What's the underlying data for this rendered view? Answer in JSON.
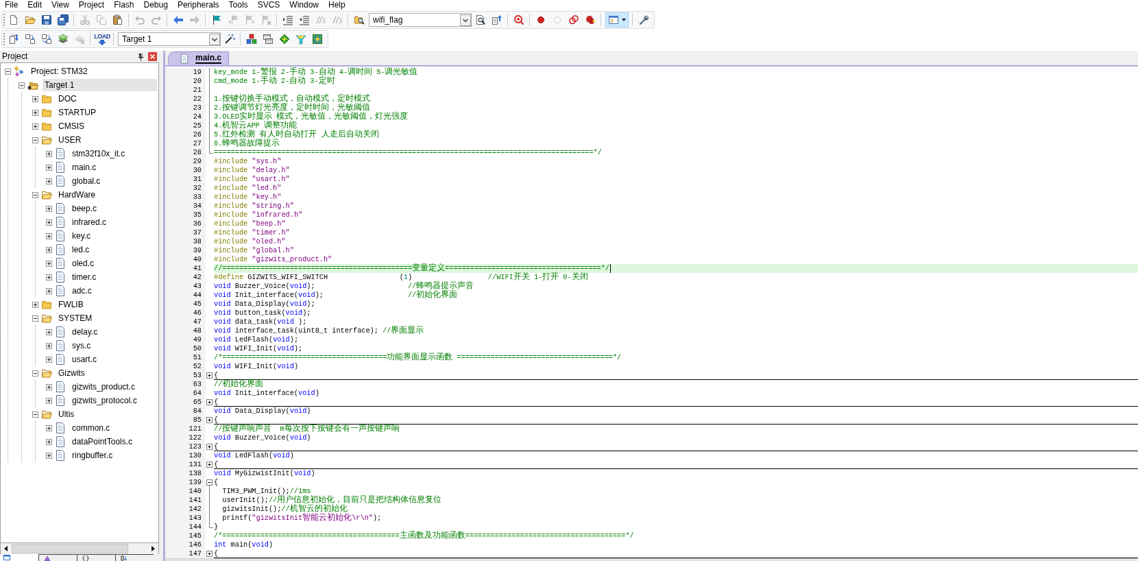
{
  "menu": [
    "File",
    "Edit",
    "View",
    "Project",
    "Flash",
    "Debug",
    "Peripherals",
    "Tools",
    "SVCS",
    "Window",
    "Help"
  ],
  "toolbar_1": [
    {
      "kind": "new",
      "disabled": false,
      "pressed": false
    },
    {
      "kind": "open",
      "disabled": false,
      "pressed": false
    },
    {
      "kind": "save",
      "disabled": false,
      "pressed": false
    },
    {
      "kind": "saveall",
      "disabled": false,
      "pressed": false
    },
    {
      "kind": "separator"
    },
    {
      "kind": "cut",
      "disabled": true,
      "pressed": false
    },
    {
      "kind": "copy",
      "disabled": true,
      "pressed": false
    },
    {
      "kind": "paste",
      "disabled": false,
      "pressed": false
    },
    {
      "kind": "separator"
    },
    {
      "kind": "undo",
      "disabled": true,
      "pressed": false
    },
    {
      "kind": "redo",
      "disabled": true,
      "pressed": false
    },
    {
      "kind": "separator"
    },
    {
      "kind": "back",
      "disabled": false,
      "pressed": false
    },
    {
      "kind": "forward",
      "disabled": true,
      "pressed": false
    },
    {
      "kind": "separator"
    },
    {
      "kind": "bookmark",
      "disabled": false,
      "pressed": false
    },
    {
      "kind": "prevbookmark",
      "disabled": true,
      "pressed": false
    },
    {
      "kind": "nextbookmark",
      "disabled": true,
      "pressed": false
    },
    {
      "kind": "clearbookmarks",
      "disabled": true,
      "pressed": false
    },
    {
      "kind": "separator"
    },
    {
      "kind": "indent",
      "disabled": false,
      "pressed": false
    },
    {
      "kind": "unindent",
      "disabled": false,
      "pressed": false
    },
    {
      "kind": "comment",
      "disabled": true,
      "pressed": false
    },
    {
      "kind": "uncomment",
      "disabled": true,
      "pressed": false
    },
    {
      "kind": "separator"
    },
    {
      "kind": "findinfiles",
      "disabled": false,
      "pressed": false
    },
    {
      "kind": "combo",
      "value": "wifi_flag"
    },
    {
      "kind": "find",
      "disabled": false,
      "pressed": false
    },
    {
      "kind": "incfind",
      "disabled": false,
      "pressed": false
    },
    {
      "kind": "separator"
    },
    {
      "kind": "debug",
      "disabled": false,
      "pressed": false
    },
    {
      "kind": "separator"
    },
    {
      "kind": "breakpoint",
      "disabled": false,
      "pressed": false
    },
    {
      "kind": "togglebreakpoint",
      "disabled": true,
      "pressed": false
    },
    {
      "kind": "disablebreakpoints",
      "disabled": false,
      "pressed": false
    },
    {
      "kind": "killbreakpoints",
      "disabled": false,
      "pressed": false
    },
    {
      "kind": "separator"
    },
    {
      "kind": "windows",
      "disabled": false,
      "pressed": true
    },
    {
      "kind": "separator"
    },
    {
      "kind": "wrench",
      "disabled": false,
      "pressed": false
    }
  ],
  "toolbar_2": [
    {
      "kind": "translate",
      "disabled": false,
      "pressed": false
    },
    {
      "kind": "build",
      "disabled": false,
      "pressed": false
    },
    {
      "kind": "rebuild",
      "disabled": false,
      "pressed": false
    },
    {
      "kind": "batchbuild",
      "disabled": false,
      "pressed": false
    },
    {
      "kind": "stopbuild",
      "disabled": true,
      "pressed": false
    },
    {
      "kind": "separator"
    },
    {
      "kind": "download",
      "label": "LOAD",
      "disabled": false,
      "pressed": false
    },
    {
      "kind": "separator"
    },
    {
      "kind": "combo",
      "value": "Target 1"
    },
    {
      "kind": "targetoptions",
      "disabled": false,
      "pressed": false
    },
    {
      "kind": "separator"
    },
    {
      "kind": "components",
      "disabled": false,
      "pressed": false
    },
    {
      "kind": "multiproject",
      "disabled": false,
      "pressed": false
    },
    {
      "kind": "packs",
      "disabled": false,
      "pressed": false
    },
    {
      "kind": "packinstaller",
      "disabled": false,
      "pressed": false
    },
    {
      "kind": "runtime",
      "disabled": false,
      "pressed": false
    }
  ],
  "project_panel": {
    "title": "Project",
    "tree": [
      {
        "label": "Project: STM32",
        "kind": "project",
        "expanded": true,
        "selected": false,
        "children": [
          {
            "label": "Target 1",
            "kind": "target",
            "expanded": true,
            "selected": true,
            "children": [
              {
                "label": "DOC",
                "kind": "group",
                "expanded": false,
                "selected": false
              },
              {
                "label": "STARTUP",
                "kind": "group",
                "expanded": false,
                "selected": false
              },
              {
                "label": "CMSIS",
                "kind": "group",
                "expanded": false,
                "selected": false
              },
              {
                "label": "USER",
                "kind": "group",
                "expanded": true,
                "selected": false,
                "children": [
                  {
                    "label": "stm32f10x_it.c",
                    "kind": "file",
                    "expanded": false,
                    "selected": false
                  },
                  {
                    "label": "main.c",
                    "kind": "file",
                    "expanded": false,
                    "selected": false
                  },
                  {
                    "label": "global.c",
                    "kind": "file",
                    "expanded": false,
                    "selected": false
                  }
                ]
              },
              {
                "label": "HardWare",
                "kind": "group",
                "expanded": true,
                "selected": false,
                "children": [
                  {
                    "label": "beep.c",
                    "kind": "file",
                    "expanded": false,
                    "selected": false
                  },
                  {
                    "label": "infrared.c",
                    "kind": "file",
                    "expanded": false,
                    "selected": false
                  },
                  {
                    "label": "key.c",
                    "kind": "file",
                    "expanded": false,
                    "selected": false
                  },
                  {
                    "label": "led.c",
                    "kind": "file",
                    "expanded": false,
                    "selected": false
                  },
                  {
                    "label": "oled.c",
                    "kind": "file",
                    "expanded": false,
                    "selected": false
                  },
                  {
                    "label": "timer.c",
                    "kind": "file",
                    "expanded": false,
                    "selected": false
                  },
                  {
                    "label": "adc.c",
                    "kind": "file",
                    "expanded": false,
                    "selected": false
                  }
                ]
              },
              {
                "label": "FWLIB",
                "kind": "group",
                "expanded": false,
                "selected": false
              },
              {
                "label": "SYSTEM",
                "kind": "group",
                "expanded": true,
                "selected": false,
                "children": [
                  {
                    "label": "delay.c",
                    "kind": "file",
                    "expanded": false,
                    "selected": false
                  },
                  {
                    "label": "sys.c",
                    "kind": "file",
                    "expanded": false,
                    "selected": false
                  },
                  {
                    "label": "usart.c",
                    "kind": "file",
                    "expanded": false,
                    "selected": false
                  }
                ]
              },
              {
                "label": "Gizwits",
                "kind": "group",
                "expanded": true,
                "selected": false,
                "children": [
                  {
                    "label": "gizwits_product.c",
                    "kind": "file",
                    "expanded": false,
                    "selected": false
                  },
                  {
                    "label": "gizwits_protocol.c",
                    "kind": "file",
                    "expanded": false,
                    "selected": false
                  }
                ]
              },
              {
                "label": "Ultis",
                "kind": "group",
                "expanded": true,
                "selected": false,
                "children": [
                  {
                    "label": "common.c",
                    "kind": "file",
                    "expanded": false,
                    "selected": false
                  },
                  {
                    "label": "dataPointTools.c",
                    "kind": "file",
                    "expanded": false,
                    "selected": false
                  },
                  {
                    "label": "ringbuffer.c",
                    "kind": "file",
                    "expanded": false,
                    "selected": false
                  }
                ]
              }
            ]
          }
        ]
      }
    ],
    "tabs": [
      {
        "kind": "project",
        "selected": true
      },
      {
        "kind": "books",
        "selected": false
      },
      {
        "kind": "functions",
        "selected": false
      },
      {
        "kind": "templates",
        "selected": false
      }
    ]
  },
  "editor": {
    "tabs": [
      {
        "label": "main.c",
        "selected": true
      }
    ],
    "lines": [
      {
        "number": "19",
        "kind": "body",
        "highlighted": false,
        "tokens": [
          {
            "kind": "comment",
            "text": "key_mode 1-警报 2-手动 3-自动 4-调时间 5-调光敏值"
          }
        ]
      },
      {
        "number": "20",
        "kind": "body",
        "highlighted": false,
        "tokens": [
          {
            "kind": "comment",
            "text": "cmd_mode 1-手动 2-自动 3-定时"
          }
        ]
      },
      {
        "number": "21",
        "kind": "body",
        "highlighted": false
      },
      {
        "number": "22",
        "kind": "body",
        "highlighted": false,
        "tokens": [
          {
            "kind": "comment",
            "text": "1.按键切换手动模式，自动模式，定时模式"
          }
        ]
      },
      {
        "number": "23",
        "kind": "body",
        "highlighted": false,
        "tokens": [
          {
            "kind": "comment",
            "text": "2.按键调节灯光亮度，定时时间，光敏阈值"
          }
        ]
      },
      {
        "number": "24",
        "kind": "body",
        "highlighted": false,
        "tokens": [
          {
            "kind": "comment",
            "text": "3.OLED实时显示 模式，光敏值，光敏阈值，灯光强度"
          }
        ]
      },
      {
        "number": "25",
        "kind": "body",
        "highlighted": false,
        "tokens": [
          {
            "kind": "comment",
            "text": "4.机智云APP 调整功能"
          }
        ]
      },
      {
        "number": "26",
        "kind": "body",
        "highlighted": false,
        "tokens": [
          {
            "kind": "comment",
            "text": "5.红外检测 有人时自动打开 人走后自动关闭"
          }
        ]
      },
      {
        "number": "27",
        "kind": "body",
        "highlighted": false,
        "tokens": [
          {
            "kind": "comment",
            "text": "6.蜂鸣器故障提示"
          }
        ]
      },
      {
        "number": "28",
        "kind": "end",
        "highlighted": false,
        "tokens": [
          {
            "kind": "comment",
            "text": "==========================================================================================*/"
          }
        ]
      },
      {
        "number": "29",
        "kind": "plain",
        "highlighted": false,
        "tokens": [
          {
            "kind": "preproc",
            "text": "#include"
          },
          {
            "kind": "string",
            "text": " \"sys.h\""
          }
        ]
      },
      {
        "number": "30",
        "kind": "plain",
        "highlighted": false,
        "tokens": [
          {
            "kind": "preproc",
            "text": "#include"
          },
          {
            "kind": "string",
            "text": " \"delay.h\""
          }
        ]
      },
      {
        "number": "31",
        "kind": "plain",
        "highlighted": false,
        "tokens": [
          {
            "kind": "preproc",
            "text": "#include"
          },
          {
            "kind": "string",
            "text": " \"usart.h\""
          }
        ]
      },
      {
        "number": "32",
        "kind": "plain",
        "highlighted": false,
        "tokens": [
          {
            "kind": "preproc",
            "text": "#include"
          },
          {
            "kind": "string",
            "text": " \"led.h\""
          }
        ]
      },
      {
        "number": "33",
        "kind": "plain",
        "highlighted": false,
        "tokens": [
          {
            "kind": "preproc",
            "text": "#include"
          },
          {
            "kind": "string",
            "text": " \"key.h\""
          }
        ]
      },
      {
        "number": "34",
        "kind": "plain",
        "highlighted": false,
        "tokens": [
          {
            "kind": "preproc",
            "text": "#include"
          },
          {
            "kind": "string",
            "text": " \"string.h\""
          }
        ]
      },
      {
        "number": "35",
        "kind": "plain",
        "highlighted": false,
        "tokens": [
          {
            "kind": "preproc",
            "text": "#include"
          },
          {
            "kind": "string",
            "text": " \"infrared.h\""
          }
        ]
      },
      {
        "number": "36",
        "kind": "plain",
        "highlighted": false,
        "tokens": [
          {
            "kind": "preproc",
            "text": "#include"
          },
          {
            "kind": "string",
            "text": " \"beep.h\""
          }
        ]
      },
      {
        "number": "37",
        "kind": "plain",
        "highlighted": false,
        "tokens": [
          {
            "kind": "preproc",
            "text": "#include"
          },
          {
            "kind": "string",
            "text": " \"timer.h\""
          }
        ]
      },
      {
        "number": "38",
        "kind": "plain",
        "highlighted": false,
        "tokens": [
          {
            "kind": "preproc",
            "text": "#include"
          },
          {
            "kind": "string",
            "text": " \"oled.h\""
          }
        ]
      },
      {
        "number": "39",
        "kind": "plain",
        "highlighted": false,
        "tokens": [
          {
            "kind": "preproc",
            "text": "#include"
          },
          {
            "kind": "string",
            "text": " \"global.h\""
          }
        ]
      },
      {
        "number": "40",
        "kind": "plain",
        "highlighted": false,
        "tokens": [
          {
            "kind": "preproc",
            "text": "#include"
          },
          {
            "kind": "string",
            "text": " \"gizwits_product.h\""
          }
        ]
      },
      {
        "number": "41",
        "kind": "plain",
        "highlighted": true,
        "tokens": [
          {
            "kind": "comment",
            "text": "//=============================================变量定义=====================================*/"
          }
        ]
      },
      {
        "number": "42",
        "kind": "plain",
        "highlighted": false,
        "tokens": [
          {
            "kind": "preproc",
            "text": "#define"
          },
          {
            "kind": "plain",
            "text": " GIZWITS_WIFI_SWITCH                 ("
          },
          {
            "kind": "number",
            "text": "1"
          },
          {
            "kind": "plain",
            "text": ")                  "
          },
          {
            "kind": "comment",
            "text": "//WIFI开关 1-打开 0-关闭"
          }
        ]
      },
      {
        "number": "43",
        "kind": "plain",
        "highlighted": false,
        "tokens": [
          {
            "kind": "keyword",
            "text": "void"
          },
          {
            "kind": "plain",
            "text": " Buzzer_Voice("
          },
          {
            "kind": "keyword",
            "text": "void"
          },
          {
            "kind": "plain",
            "text": ");                      "
          },
          {
            "kind": "comment",
            "text": "//蜂鸣器提示声音"
          }
        ]
      },
      {
        "number": "44",
        "kind": "plain",
        "highlighted": false,
        "tokens": [
          {
            "kind": "keyword",
            "text": "void"
          },
          {
            "kind": "plain",
            "text": " Init_interface("
          },
          {
            "kind": "keyword",
            "text": "void"
          },
          {
            "kind": "plain",
            "text": ");                    "
          },
          {
            "kind": "comment",
            "text": "//初始化界面"
          }
        ]
      },
      {
        "number": "45",
        "kind": "plain",
        "highlighted": false,
        "tokens": [
          {
            "kind": "keyword",
            "text": "void"
          },
          {
            "kind": "plain",
            "text": " Data_Display("
          },
          {
            "kind": "keyword",
            "text": "void"
          },
          {
            "kind": "plain",
            "text": ");"
          }
        ]
      },
      {
        "number": "46",
        "kind": "plain",
        "highlighted": false,
        "tokens": [
          {
            "kind": "keyword",
            "text": "void"
          },
          {
            "kind": "plain",
            "text": " button_task("
          },
          {
            "kind": "keyword",
            "text": "void"
          },
          {
            "kind": "plain",
            "text": ");"
          }
        ]
      },
      {
        "number": "47",
        "kind": "plain",
        "highlighted": false,
        "tokens": [
          {
            "kind": "keyword",
            "text": "void"
          },
          {
            "kind": "plain",
            "text": " data_task("
          },
          {
            "kind": "keyword",
            "text": "void"
          },
          {
            "kind": "plain",
            "text": " );"
          }
        ]
      },
      {
        "number": "48",
        "kind": "plain",
        "highlighted": false,
        "tokens": [
          {
            "kind": "keyword",
            "text": "void"
          },
          {
            "kind": "plain",
            "text": " interface_task(uint8_t interface); "
          },
          {
            "kind": "comment",
            "text": "//界面显示"
          }
        ]
      },
      {
        "number": "49",
        "kind": "plain",
        "highlighted": false,
        "tokens": [
          {
            "kind": "keyword",
            "text": "void"
          },
          {
            "kind": "plain",
            "text": " LedFlash("
          },
          {
            "kind": "keyword",
            "text": "void"
          },
          {
            "kind": "plain",
            "text": ");"
          }
        ]
      },
      {
        "number": "50",
        "kind": "plain",
        "highlighted": false,
        "tokens": [
          {
            "kind": "keyword",
            "text": "void"
          },
          {
            "kind": "plain",
            "text": " WIFI_Init("
          },
          {
            "kind": "keyword",
            "text": "void"
          },
          {
            "kind": "plain",
            "text": ");"
          }
        ]
      },
      {
        "number": "51",
        "kind": "plain",
        "highlighted": false,
        "tokens": [
          {
            "kind": "comment",
            "text": "/*=======================================功能界面显示函数 =====================================*/"
          }
        ]
      },
      {
        "number": "52",
        "kind": "plain",
        "highlighted": false,
        "tokens": [
          {
            "kind": "keyword",
            "text": "void"
          },
          {
            "kind": "plain",
            "text": " WIFI_Init("
          },
          {
            "kind": "keyword",
            "text": "void"
          },
          {
            "kind": "plain",
            "text": ")"
          }
        ]
      },
      {
        "number": "53",
        "kind": "collapsed",
        "highlighted": false,
        "tokens": [
          {
            "kind": "plain",
            "text": "{"
          }
        ]
      },
      {
        "number": "63",
        "kind": "plain",
        "highlighted": false,
        "tokens": [
          {
            "kind": "comment",
            "text": "//初始化界面"
          }
        ]
      },
      {
        "number": "64",
        "kind": "plain",
        "highlighted": false,
        "tokens": [
          {
            "kind": "keyword",
            "text": "void"
          },
          {
            "kind": "plain",
            "text": " Init_interface("
          },
          {
            "kind": "keyword",
            "text": "void"
          },
          {
            "kind": "plain",
            "text": ")"
          }
        ]
      },
      {
        "number": "65",
        "kind": "collapsed",
        "highlighted": false,
        "tokens": [
          {
            "kind": "plain",
            "text": "{"
          }
        ]
      },
      {
        "number": "84",
        "kind": "plain",
        "highlighted": false,
        "tokens": [
          {
            "kind": "keyword",
            "text": "void"
          },
          {
            "kind": "plain",
            "text": " Data_Display("
          },
          {
            "kind": "keyword",
            "text": "void"
          },
          {
            "kind": "plain",
            "text": ")"
          }
        ]
      },
      {
        "number": "85",
        "kind": "collapsed",
        "highlighted": false,
        "tokens": [
          {
            "kind": "plain",
            "text": "{"
          }
        ]
      },
      {
        "number": "121",
        "kind": "plain",
        "highlighted": false,
        "tokens": [
          {
            "kind": "comment",
            "text": "//按键声响声音  m每次按下按键会有一声按键声响"
          }
        ]
      },
      {
        "number": "122",
        "kind": "plain",
        "highlighted": false,
        "tokens": [
          {
            "kind": "keyword",
            "text": "void"
          },
          {
            "kind": "plain",
            "text": " Buzzer_Voice("
          },
          {
            "kind": "keyword",
            "text": "void"
          },
          {
            "kind": "plain",
            "text": ")"
          }
        ]
      },
      {
        "number": "123",
        "kind": "collapsed",
        "highlighted": false,
        "tokens": [
          {
            "kind": "plain",
            "text": "{"
          }
        ]
      },
      {
        "number": "130",
        "kind": "plain",
        "highlighted": false,
        "tokens": [
          {
            "kind": "keyword",
            "text": "void"
          },
          {
            "kind": "plain",
            "text": " LedFlash("
          },
          {
            "kind": "keyword",
            "text": "void"
          },
          {
            "kind": "plain",
            "text": ")"
          }
        ]
      },
      {
        "number": "131",
        "kind": "collapsed",
        "highlighted": false,
        "tokens": [
          {
            "kind": "plain",
            "text": "{"
          }
        ]
      },
      {
        "number": "138",
        "kind": "plain",
        "highlighted": false,
        "tokens": [
          {
            "kind": "keyword",
            "text": "void"
          },
          {
            "kind": "plain",
            "text": " MyGizwistInit("
          },
          {
            "kind": "keyword",
            "text": "void"
          },
          {
            "kind": "plain",
            "text": ")"
          }
        ]
      },
      {
        "number": "139",
        "kind": "expanded",
        "highlighted": false,
        "tokens": [
          {
            "kind": "plain",
            "text": "{"
          }
        ]
      },
      {
        "number": "140",
        "kind": "body",
        "highlighted": false,
        "tokens": [
          {
            "kind": "plain",
            "text": "  TIM3_PWM_Init();"
          },
          {
            "kind": "comment",
            "text": "//1ms"
          }
        ]
      },
      {
        "number": "141",
        "kind": "body",
        "highlighted": false,
        "tokens": [
          {
            "kind": "plain",
            "text": "  userInit();"
          },
          {
            "kind": "comment",
            "text": "//用户信息初始化，目前只是把结构体信息复位"
          }
        ]
      },
      {
        "number": "142",
        "kind": "body",
        "highlighted": false,
        "tokens": [
          {
            "kind": "plain",
            "text": "  gizwitsInit();"
          },
          {
            "kind": "comment",
            "text": "//机智云的初始化"
          }
        ]
      },
      {
        "number": "143",
        "kind": "body",
        "highlighted": false,
        "tokens": [
          {
            "kind": "plain",
            "text": "  printf("
          },
          {
            "kind": "string",
            "text": "\"gizwitsInit智能云初始化\\r\\n\""
          },
          {
            "kind": "plain",
            "text": ");"
          }
        ]
      },
      {
        "number": "144",
        "kind": "end",
        "highlighted": false,
        "tokens": [
          {
            "kind": "plain",
            "text": "}"
          }
        ]
      },
      {
        "number": "145",
        "kind": "plain",
        "highlighted": false,
        "tokens": [
          {
            "kind": "comment",
            "text": "/*==========================================主函数及功能函数======================================*/"
          }
        ]
      },
      {
        "number": "146",
        "kind": "plain",
        "highlighted": false,
        "tokens": [
          {
            "kind": "keyword",
            "text": "int"
          },
          {
            "kind": "plain",
            "text": " main("
          },
          {
            "kind": "keyword",
            "text": "void"
          },
          {
            "kind": "plain",
            "text": ")"
          }
        ]
      },
      {
        "number": "147",
        "kind": "collapsed",
        "highlighted": false,
        "tokens": [
          {
            "kind": "plain",
            "text": "{"
          }
        ]
      }
    ]
  }
}
